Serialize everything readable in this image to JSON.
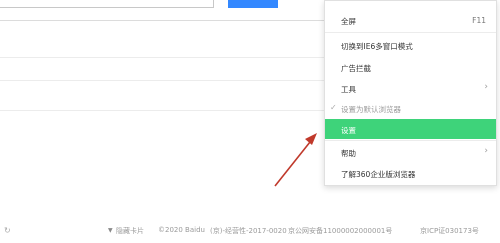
{
  "menu": {
    "items": [
      {
        "label": "全屏",
        "shortcut": "F11"
      },
      {
        "label": "切换到IE6多窗口模式"
      },
      {
        "label": "广告拦截"
      },
      {
        "label": "工具",
        "submenu": true
      },
      {
        "label": "设置为默认浏览器",
        "disabled": true,
        "checked": true
      },
      {
        "label": "设置",
        "highlighted": true
      },
      {
        "label": "帮助",
        "submenu": true
      },
      {
        "label": "了解360企业版浏览器"
      }
    ],
    "highlight_color": "#3ed37a"
  },
  "footer": {
    "hide_card": "隐藏卡片",
    "copyright": "©2020 Baidu",
    "license": "(京)-经营性-2017-0020",
    "beian": "京公网安备11000002000001号",
    "icp": "京ICP证030173号"
  },
  "annotation": {
    "arrow_color": "#c0392b"
  },
  "icons": {
    "left_footer": "refresh-icon",
    "submenu": "chevron-right-icon",
    "check": "check-icon",
    "hide_card": "chevron-down-icon"
  }
}
